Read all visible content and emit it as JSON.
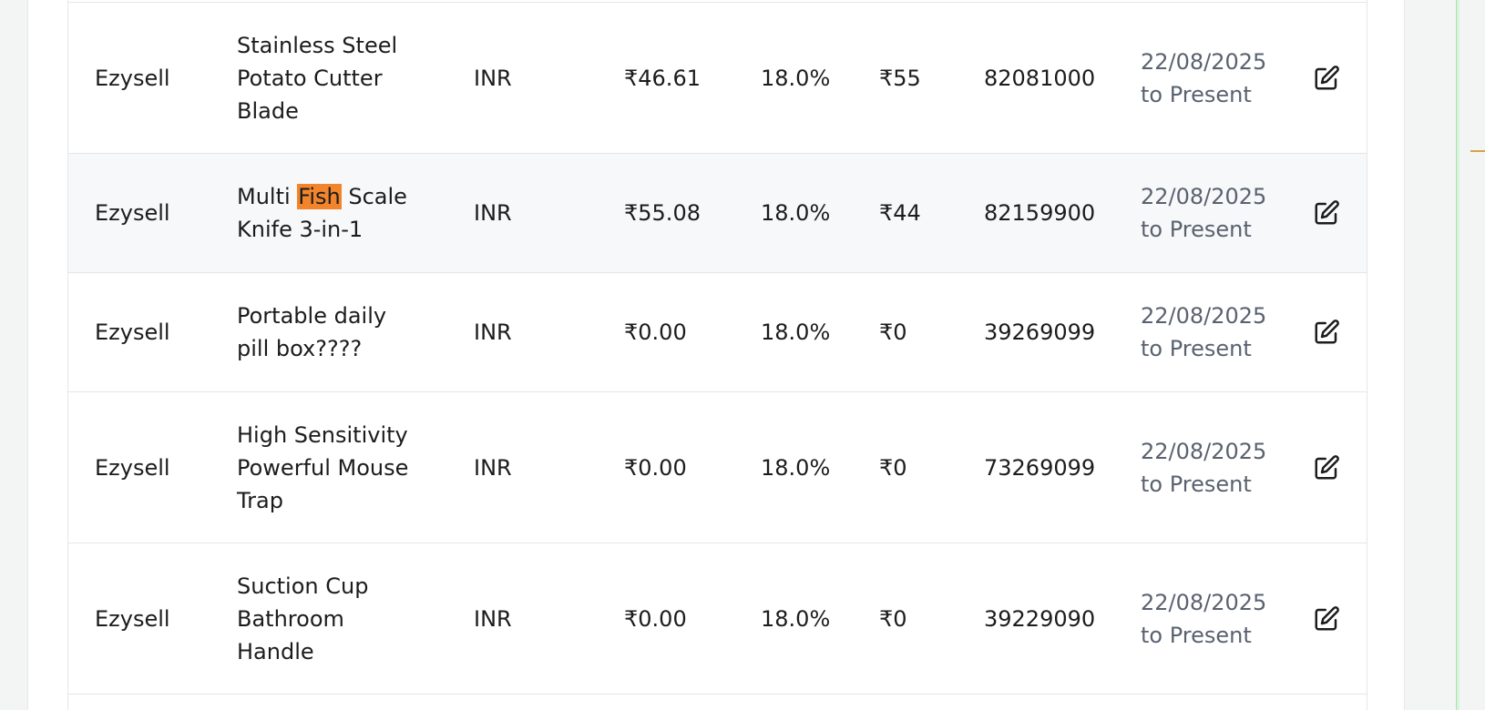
{
  "colors": {
    "highlight": "#f2852b",
    "date_text": "#5a6270",
    "row_alt_bg": "#f7f8fa",
    "border": "#e3e6e8"
  },
  "icons": {
    "edit": "edit-icon"
  },
  "rows": [
    {
      "seller": "Ezysell",
      "product_before": "Stainless Steel Potato Cutter Blade",
      "product_match": "",
      "product_after": "",
      "currency": "INR",
      "price": "₹46.61",
      "tax": "18.0%",
      "amount": "₹55",
      "hsn": "82081000",
      "date_from": "22/08/2025",
      "date_to": "to Present"
    },
    {
      "seller": "Ezysell",
      "product_before": "Multi ",
      "product_match": "Fish",
      "product_after": " Scale Knife 3-in-1",
      "currency": "INR",
      "price": "₹55.08",
      "tax": "18.0%",
      "amount": "₹44",
      "hsn": "82159900",
      "date_from": "22/08/2025",
      "date_to": "to Present"
    },
    {
      "seller": "Ezysell",
      "product_before": "Portable daily pill box????",
      "product_match": "",
      "product_after": "",
      "currency": "INR",
      "price": "₹0.00",
      "tax": "18.0%",
      "amount": "₹0",
      "hsn": "39269099",
      "date_from": "22/08/2025",
      "date_to": "to Present"
    },
    {
      "seller": "Ezysell",
      "product_before": "High Sensitivity Powerful Mouse Trap",
      "product_match": "",
      "product_after": "",
      "currency": "INR",
      "price": "₹0.00",
      "tax": "18.0%",
      "amount": "₹0",
      "hsn": "73269099",
      "date_from": "22/08/2025",
      "date_to": "to Present"
    },
    {
      "seller": "Ezysell",
      "product_before": "Suction Cup Bathroom Handle",
      "product_match": "",
      "product_after": "",
      "currency": "INR",
      "price": "₹0.00",
      "tax": "18.0%",
      "amount": "₹0",
      "hsn": "39229090",
      "date_from": "22/08/2025",
      "date_to": "to Present"
    }
  ]
}
